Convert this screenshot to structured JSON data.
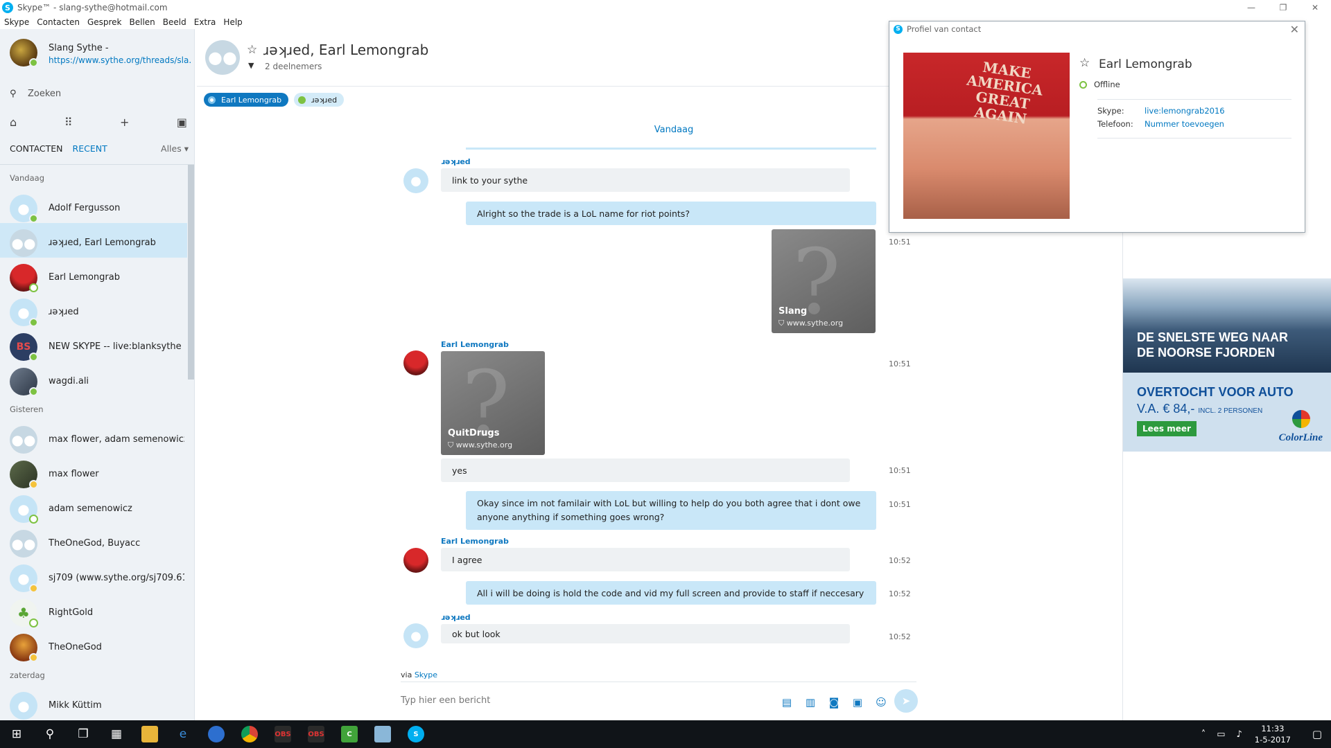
{
  "window": {
    "title": "Skype™ - slang-sythe@hotmail.com",
    "minimize": "—",
    "restore": "❐",
    "close": "✕"
  },
  "menu": [
    "Skype",
    "Contacten",
    "Gesprek",
    "Bellen",
    "Beeld",
    "Extra",
    "Help"
  ],
  "profile": {
    "name": "Slang Sythe -",
    "mood": "https://www.sythe.org/threads/sla..."
  },
  "search": {
    "placeholder": "Zoeken"
  },
  "tabs": {
    "contacts": "CONTACTEN",
    "recent": "RECENT",
    "filter": "Alles"
  },
  "sections": {
    "today": "Vandaag",
    "yesterday": "Gisteren",
    "saturday": "zaterdag"
  },
  "contacts_today": [
    {
      "name": "Adolf Fergusson",
      "status": "online"
    },
    {
      "name": "ɹəʞɹed, Earl Lemongrab",
      "status": "group"
    },
    {
      "name": "Earl Lemongrab",
      "status": "offline"
    },
    {
      "name": "ɹəʞɹed",
      "status": "online"
    },
    {
      "name": "NEW SKYPE -- live:blanksythe",
      "status": "online"
    },
    {
      "name": "wagdi.ali",
      "status": "online"
    }
  ],
  "contacts_yesterday": [
    {
      "name": "max flower, adam semenowicz",
      "status": "group"
    },
    {
      "name": "max flower",
      "status": "away"
    },
    {
      "name": "adam semenowicz",
      "status": "offline"
    },
    {
      "name": "TheOneGod, Buyacc",
      "status": "group"
    },
    {
      "name": "sj709 (www.sythe.org/sj709.61...",
      "status": "away"
    },
    {
      "name": "RightGold",
      "status": "offline"
    },
    {
      "name": "TheOneGod",
      "status": "away"
    }
  ],
  "contacts_saturday": [
    {
      "name": "Mikk Küttim",
      "status": "offline"
    }
  ],
  "chat": {
    "title": "ɹəʞɹed, Earl Lemongrab",
    "participants": "2 deelnemers",
    "chips": [
      "Earl Lemongrab",
      "ɹəʞɹed"
    ],
    "date_divider": "Vandaag",
    "sender_parker": "ɹəʞɹed",
    "sender_earl": "Earl Lemongrab",
    "messages": {
      "m1": "link to your sythe",
      "m2": "Alright so the trade is a LoL name for riot points?",
      "m3_card_title": "Slang",
      "m3_card_url": "www.sythe.org",
      "m3_time": "10:51",
      "m4_card_title": "QuitDrugs",
      "m4_card_url": "www.sythe.org",
      "m4_time": "10:51",
      "m5": "yes",
      "m5_time": "10:51",
      "m6": "Okay since im not familair with LoL but willing to help do you both agree that i dont owe anyone anything if something goes wrong?",
      "m6_time": "10:51",
      "m7": "I agree",
      "m7_time": "10:52",
      "m8": "All i will be doing is hold the code and vid my full screen and provide to staff if neccesary",
      "m8_time": "10:52",
      "m9": "ok but look",
      "m9_time": "10:52"
    },
    "via_prefix": "via",
    "via_link": "Skype",
    "compose_placeholder": "Typ hier een bericht"
  },
  "popup": {
    "title": "Profiel van contact",
    "photo_caption": "MAKE AMERICA GREAT AGAIN",
    "name": "Earl Lemongrab",
    "status": "Offline",
    "skype_label": "Skype:",
    "skype_value": "live:lemongrab2016",
    "phone_label": "Telefoon:",
    "phone_value": "Nummer toevoegen"
  },
  "ad": {
    "headline": "DE SNELSTE WEG NAAR DE NOORSE FJORDEN",
    "offer": "OVERTOCHT VOOR AUTO",
    "price": "V.A. € 84,-",
    "price_note": "INCL. 2 PERSONEN",
    "button": "Lees meer",
    "brand": "ColorLine"
  },
  "taskbar": {
    "time": "11:33",
    "date": "1-5-2017"
  }
}
